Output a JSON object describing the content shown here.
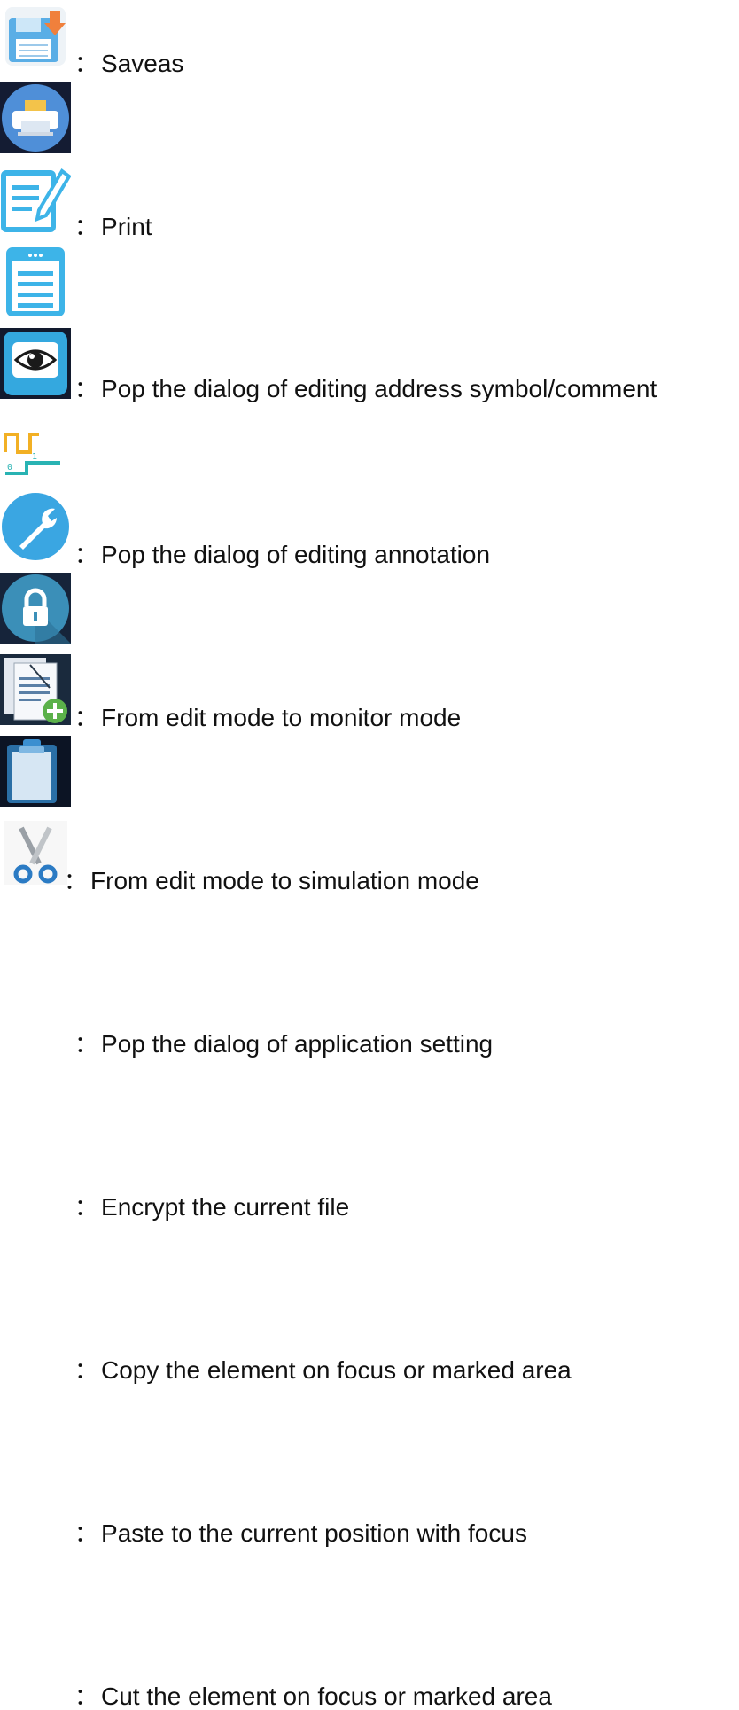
{
  "items": [
    {
      "icon": "save-as-icon",
      "label": "Saveas"
    },
    {
      "icon": "print-icon",
      "label": "Print"
    },
    {
      "icon": "edit-symbol-comment-icon",
      "label": "Pop the dialog of editing address symbol/comment"
    },
    {
      "icon": "annotation-icon",
      "label": "Pop the dialog of editing annotation"
    },
    {
      "icon": "monitor-mode-eye-icon",
      "label": "From edit mode to monitor mode"
    },
    {
      "icon": "simulation-waveform-icon",
      "label": "From edit mode to simulation mode"
    },
    {
      "icon": "wrench-settings-icon",
      "label": "Pop the dialog of application setting"
    },
    {
      "icon": "lock-icon",
      "label": "Encrypt the current file"
    },
    {
      "icon": "copy-icon",
      "label": "Copy the element on focus or marked area"
    },
    {
      "icon": "clipboard-paste-icon",
      "label": "Paste to the current position with focus"
    },
    {
      "icon": "scissors-cut-icon",
      "label": "Cut the element on focus or marked area"
    }
  ],
  "separator": "："
}
